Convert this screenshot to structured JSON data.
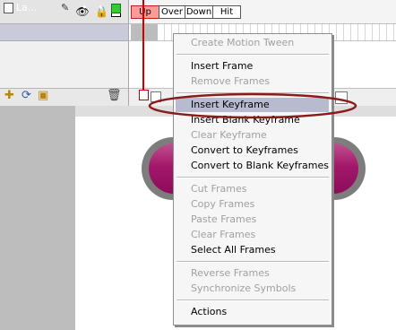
{
  "timeline": {
    "frame_labels": [
      "Up",
      "Over",
      "Down",
      "Hit"
    ],
    "layer": {
      "name": "La...",
      "visibility_dot": "•",
      "lock_dot": "•"
    },
    "header_icons": [
      "eye-icon",
      "lock-icon",
      "outline-square-icon"
    ]
  },
  "context_menu": {
    "items": [
      {
        "label": "Create Motion Tween",
        "enabled": false
      },
      {
        "label": "Insert Frame",
        "enabled": true
      },
      {
        "label": "Remove Frames",
        "enabled": false
      },
      {
        "label": "Insert Keyframe",
        "enabled": true,
        "highlighted": true
      },
      {
        "label": "Insert Blank Keyframe",
        "enabled": true
      },
      {
        "label": "Clear Keyframe",
        "enabled": false
      },
      {
        "label": "Convert to Keyframes",
        "enabled": true
      },
      {
        "label": "Convert to Blank Keyframes",
        "enabled": true
      },
      {
        "label": "Cut Frames",
        "enabled": false
      },
      {
        "label": "Copy Frames",
        "enabled": false
      },
      {
        "label": "Paste Frames",
        "enabled": false
      },
      {
        "label": "Clear Frames",
        "enabled": false
      },
      {
        "label": "Select All Frames",
        "enabled": true
      },
      {
        "label": "Reverse Frames",
        "enabled": false
      },
      {
        "label": "Synchronize Symbols",
        "enabled": false
      },
      {
        "label": "Actions",
        "enabled": true
      }
    ]
  },
  "colors": {
    "annotation": "#8b1a1a",
    "button_fill": "#a3176a",
    "layer_color": "#33cc33"
  }
}
